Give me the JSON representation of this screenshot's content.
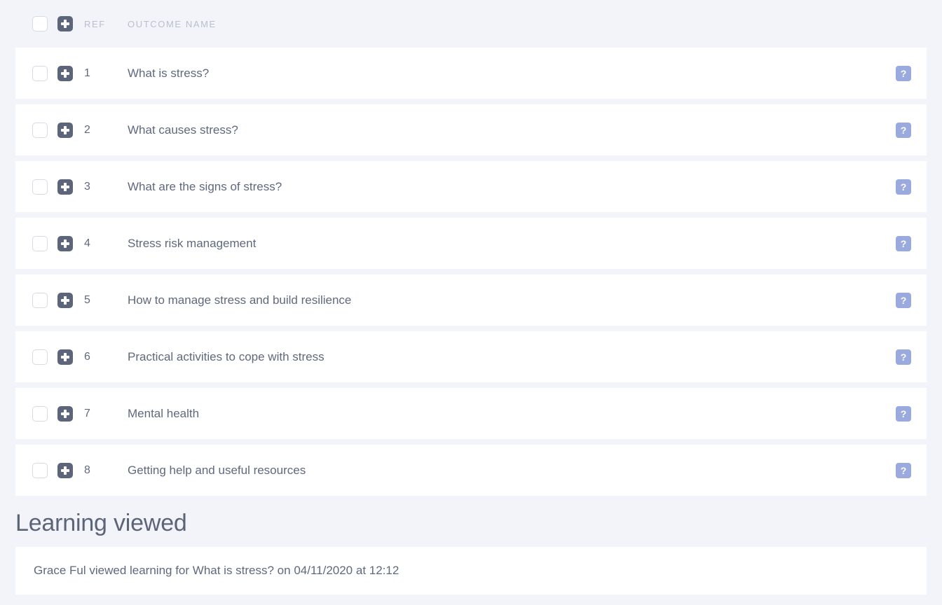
{
  "colors": {
    "page_background": "#f3f4f9",
    "card_background": "#ffffff",
    "text_primary": "#5f697d",
    "header_label": "#b9bfd1",
    "plus_badge": "#5c6579",
    "help_badge": "#9aaade",
    "heading": "#5b6577"
  },
  "table": {
    "header": {
      "select_all_checkbox": "select-all",
      "expand_all_icon": "plus-square-icon",
      "ref_label": "REF",
      "name_label": "OUTCOME NAME"
    },
    "row_icons": {
      "checkbox": "row-checkbox",
      "expand": "plus-square-icon",
      "help": "question-mark-icon",
      "help_glyph": "?"
    },
    "rows": [
      {
        "ref": "1",
        "name": "What is stress?"
      },
      {
        "ref": "2",
        "name": "What causes stress?"
      },
      {
        "ref": "3",
        "name": "What are the signs of stress?"
      },
      {
        "ref": "4",
        "name": "Stress risk management"
      },
      {
        "ref": "5",
        "name": "How to manage stress and build resilience"
      },
      {
        "ref": "6",
        "name": "Practical activities to cope with stress"
      },
      {
        "ref": "7",
        "name": "Mental health"
      },
      {
        "ref": "8",
        "name": "Getting help and useful resources"
      }
    ]
  },
  "learning_viewed": {
    "title": "Learning viewed",
    "entries": [
      {
        "text": "Grace Ful viewed learning for What is stress? on 04/11/2020 at 12:12"
      }
    ]
  }
}
